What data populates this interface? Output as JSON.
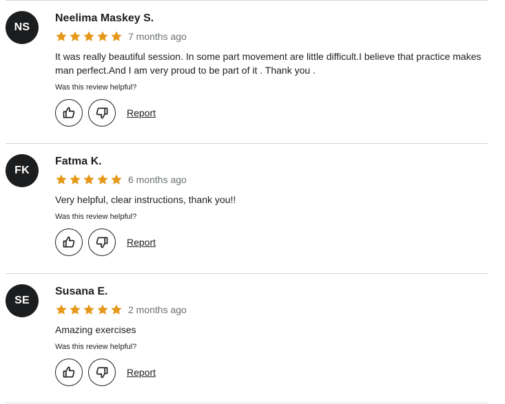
{
  "reviews": [
    {
      "initials": "NS",
      "name": "Neelima Maskey S.",
      "stars": 5,
      "date": "7 months ago",
      "comment": "It was really beautiful session. In some part movement are little difficult.I believe that practice makes man perfect.And I am very proud to be part of it . Thank you .",
      "helpful_prompt": "Was this review helpful?",
      "report_label": "Report"
    },
    {
      "initials": "FK",
      "name": "Fatma K.",
      "stars": 5,
      "date": "6 months ago",
      "comment": "Very helpful, clear instructions, thank you!!",
      "helpful_prompt": "Was this review helpful?",
      "report_label": "Report"
    },
    {
      "initials": "SE",
      "name": "Susana E.",
      "stars": 5,
      "date": "2 months ago",
      "comment": "Amazing exercises",
      "helpful_prompt": "Was this review helpful?",
      "report_label": "Report"
    }
  ],
  "colors": {
    "star": "#e59819",
    "avatar_bg": "#1c1d1f",
    "divider": "#d1d7dc",
    "muted_text": "#6a6f73"
  },
  "icons": {
    "star": "star-icon",
    "like": "thumbs-up-icon",
    "dislike": "thumbs-down-icon"
  }
}
